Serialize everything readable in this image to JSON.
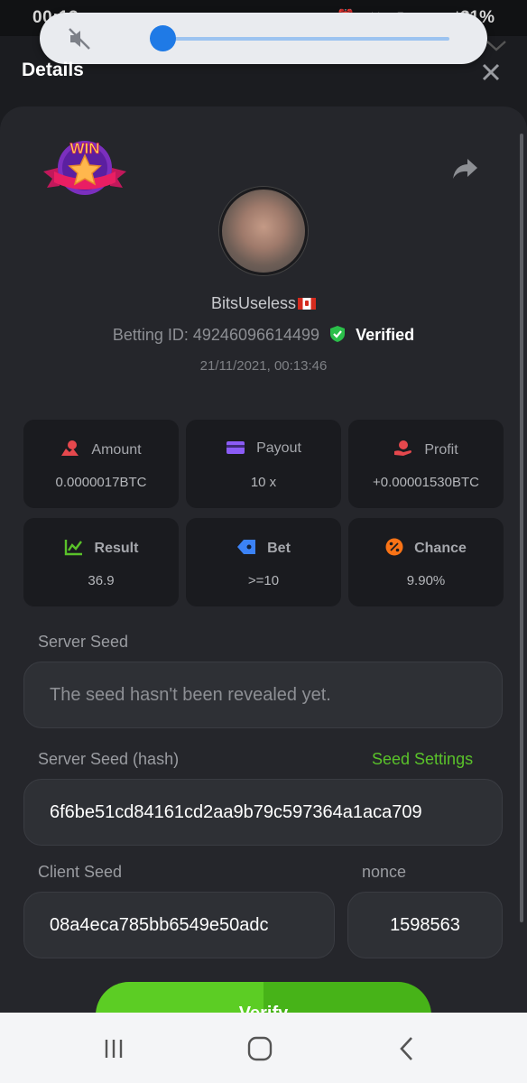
{
  "status_bar": {
    "time": "00:13",
    "left_icons": "∞ ☁",
    "right_icons": "⏰ ✕ ▮ ≋ ıll",
    "battery": "81%"
  },
  "header": {
    "title": "Details"
  },
  "player": {
    "username": "BitsUseless",
    "betting_id": "Betting ID: 49246096614499",
    "verified_label": "Verified",
    "timestamp": "21/11/2021, 00:13:46"
  },
  "badge": {
    "text": "WIN"
  },
  "stats": [
    {
      "label": "Amount",
      "value": "0.0000017BTC",
      "icon": "amount-icon",
      "color": "#e5484d"
    },
    {
      "label": "Payout",
      "value": "10 x",
      "icon": "payout-card-icon",
      "color": "#8b5cf6"
    },
    {
      "label": "Profit",
      "value": "+0.00001530BTC",
      "icon": "profit-hand-icon",
      "color": "#e5484d"
    },
    {
      "label": "Result",
      "value": "36.9",
      "icon": "result-chart-icon",
      "color": "#5ac22a"
    },
    {
      "label": "Bet",
      "value": ">=10",
      "icon": "bet-tag-icon",
      "color": "#3b82f6"
    },
    {
      "label": "Chance",
      "value": "9.90%",
      "icon": "chance-percent-icon",
      "color": "#f97316"
    }
  ],
  "server_seed": {
    "label": "Server Seed",
    "placeholder": "The seed hasn't been revealed yet."
  },
  "server_seed_hash": {
    "label": "Server Seed (hash)",
    "settings_link": "Seed Settings",
    "value": "6f6be51cd84161cd2aa9b79c597364a1aca709"
  },
  "client_seed": {
    "label": "Client Seed",
    "value": "08a4eca785bb6549e50adc"
  },
  "nonce": {
    "label": "nonce",
    "value": "1598563"
  },
  "verify_button": {
    "label": "Verify"
  },
  "colors": {
    "accent_green": "#5ac22a",
    "card_bg": "#25262b",
    "page_bg": "#1b1c20"
  }
}
